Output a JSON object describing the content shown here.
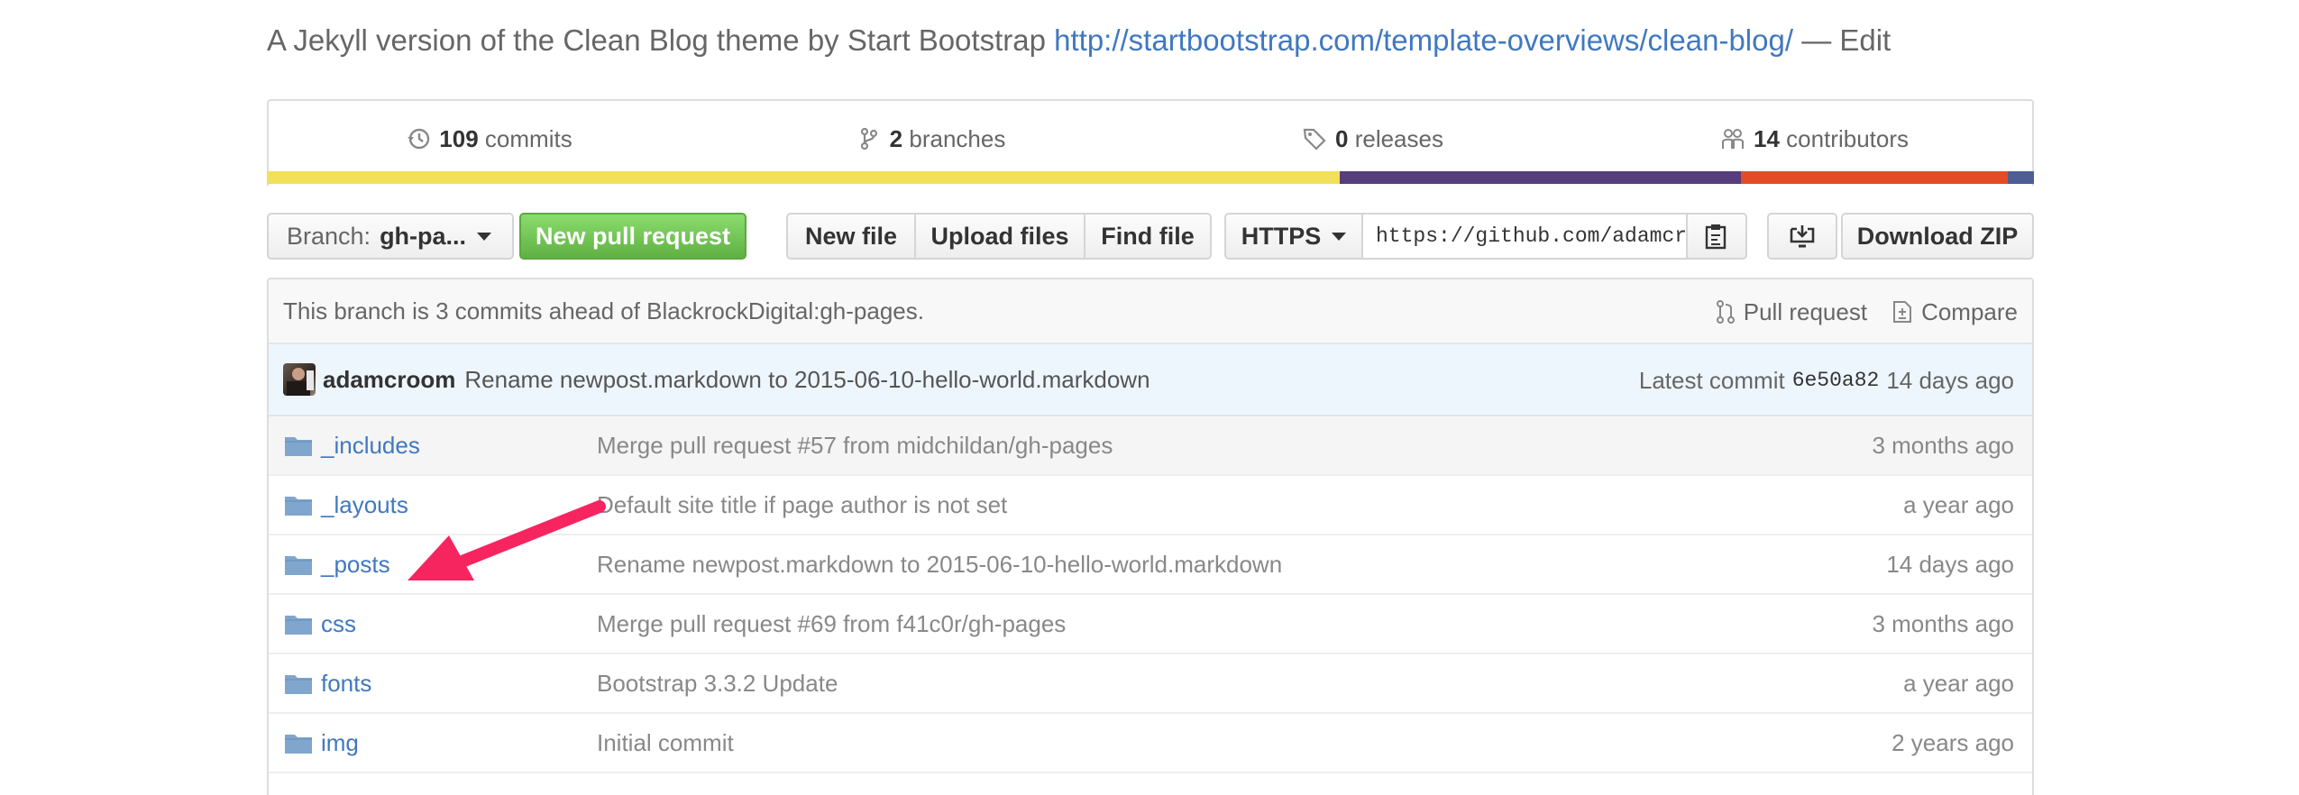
{
  "description": {
    "text": "A Jekyll version of the Clean Blog theme by Start Bootstrap",
    "link": "http://startbootstrap.com/template-overviews/clean-blog/",
    "edit": "— Edit"
  },
  "summary": {
    "commits": {
      "count": "109",
      "label": "commits",
      "icon": "history-icon"
    },
    "branches": {
      "count": "2",
      "label": "branches",
      "icon": "branch-icon"
    },
    "releases": {
      "count": "0",
      "label": "releases",
      "icon": "tag-icon"
    },
    "contributors": {
      "count": "14",
      "label": "contributors",
      "icon": "people-icon"
    }
  },
  "language_bar": [
    {
      "color": "#f1e05a",
      "share": 0.607
    },
    {
      "color": "#563d7c",
      "share": 0.227
    },
    {
      "color": "#e34c26",
      "share": 0.151
    },
    {
      "color": "#4f5d95",
      "share": 0.015
    }
  ],
  "toolbar": {
    "branch_label": "Branch:",
    "branch_value": "gh-pa...",
    "new_pull_request": "New pull request",
    "new_file": "New file",
    "upload_files": "Upload files",
    "find_file": "Find file",
    "protocol": "HTTPS",
    "clone_url": "https://github.com/adamcr",
    "download_zip": "Download ZIP"
  },
  "branch_info": {
    "text": "This branch is 3 commits ahead of BlackrockDigital:gh-pages.",
    "pull_request": "Pull request",
    "compare": "Compare"
  },
  "latest_commit": {
    "author": "adamcroom",
    "message": "Rename newpost.markdown to 2015-06-10-hello-world.markdown",
    "prefix": "Latest commit",
    "sha": "6e50a82",
    "age": "14 days ago"
  },
  "files": [
    {
      "name": "_includes",
      "message": "Merge pull request #57 from midchildan/gh-pages",
      "age": "3 months ago"
    },
    {
      "name": "_layouts",
      "message": "Default site title if page author is not set",
      "age": "a year ago"
    },
    {
      "name": "_posts",
      "message": "Rename newpost.markdown to 2015-06-10-hello-world.markdown",
      "age": "14 days ago"
    },
    {
      "name": "css",
      "message": "Merge pull request #69 from f41c0r/gh-pages",
      "age": "3 months ago"
    },
    {
      "name": "fonts",
      "message": "Bootstrap 3.3.2 Update",
      "age": "a year ago"
    },
    {
      "name": "img",
      "message": "Initial commit",
      "age": "2 years ago"
    }
  ],
  "colors": {
    "link": "#4078c0",
    "green_button": "#60b044",
    "annotation_arrow": "#f7255f"
  }
}
